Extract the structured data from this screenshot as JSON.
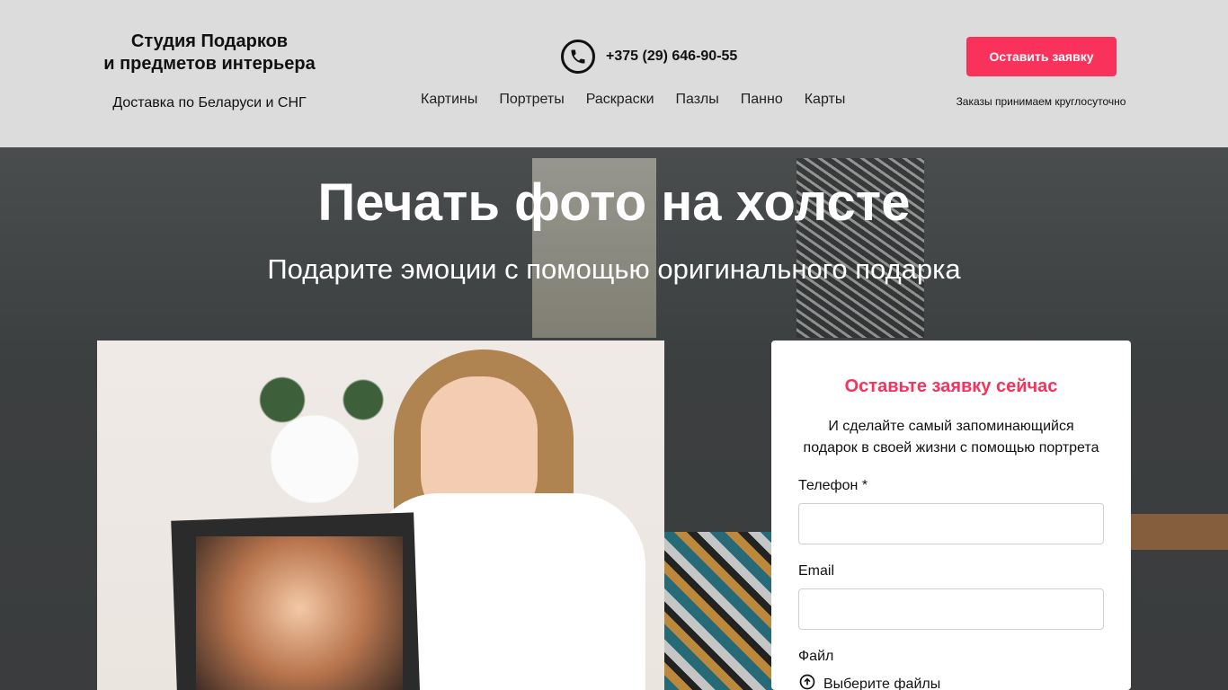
{
  "header": {
    "brand_line1": "Студия Подарков",
    "brand_line2": "и предметов интерьера",
    "delivery": "Доставка по Беларуси и СНГ",
    "phone": "+375 (29) 646-90-55",
    "nav": [
      "Картины",
      "Портреты",
      "Раскраски",
      "Пазлы",
      "Панно",
      "Карты"
    ],
    "cta_label": "Оставить заявку",
    "hours": "Заказы принимаем круглосуточно"
  },
  "hero": {
    "title": "Печать фото на холсте",
    "subtitle": "Подарите эмоции с помощью оригинального подарка"
  },
  "form": {
    "title": "Оставьте заявку сейчас",
    "desc_line1": "И сделайте самый запоминающийся",
    "desc_line2": "подарок в своей жизни с помощью портрета",
    "phone_label": "Телефон *",
    "phone_value": "",
    "email_label": "Email",
    "email_value": "",
    "file_label": "Файл",
    "file_button": "Выберите файлы"
  },
  "colors": {
    "accent": "#f9325b",
    "header_bg": "#dcdcdc"
  }
}
